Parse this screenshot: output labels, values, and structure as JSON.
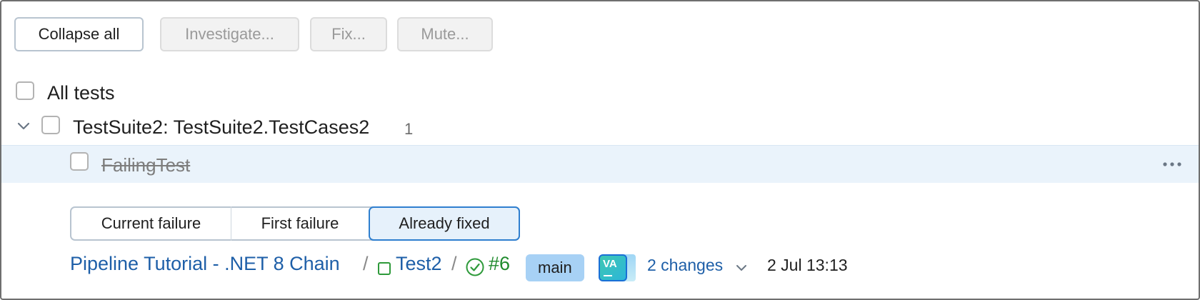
{
  "toolbar": {
    "collapse_all": "Collapse all",
    "investigate": "Investigate...",
    "fix": "Fix...",
    "mute": "Mute..."
  },
  "tree": {
    "all_tests": "All tests",
    "suite_label": "TestSuite2: TestSuite2.TestCases2",
    "suite_count": "1",
    "test_name": "FailingTest"
  },
  "tabs": {
    "current_failure": "Current failure",
    "first_failure": "First failure",
    "already_fixed": "Already fixed",
    "active": "already_fixed"
  },
  "build": {
    "project": "Pipeline Tutorial - .NET 8 Chain",
    "separator": "/",
    "config": "Test2",
    "number": "#6",
    "branch": "main",
    "avatar_initials": "VA",
    "changes": "2 changes",
    "date": "2 Jul 13:13"
  },
  "colors": {
    "link": "#1e5fa8",
    "success": "#1f8a2c",
    "branch_bg": "#a7d1f5",
    "selected_row": "#eaf3fb",
    "active_tab_border": "#2f7fcf"
  },
  "icons": {
    "expand": "chevron-down-icon",
    "more": "more-horizontal-icon",
    "config": "square-outline-icon",
    "status": "check-circle-icon",
    "changes_toggle": "chevron-down-icon"
  }
}
